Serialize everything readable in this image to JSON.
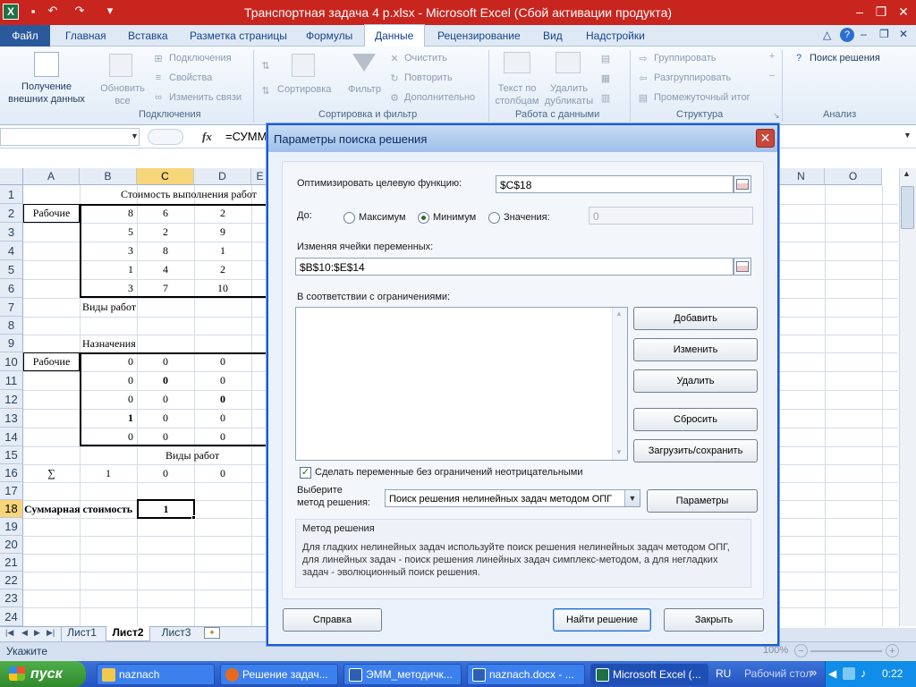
{
  "app": {
    "title": "Транспортная задача 4 р.xlsx  -  Microsoft Excel (Сбой активации продукта)"
  },
  "tabs": {
    "file": "Файл",
    "items": [
      "Главная",
      "Вставка",
      "Разметка страницы",
      "Формулы",
      "Данные",
      "Рецензирование",
      "Вид",
      "Надстройки"
    ]
  },
  "ribbon": {
    "get_external": "Получение внешних данных",
    "refresh_all": "Обновить все",
    "connections": "Подключения",
    "properties": "Свойства",
    "edit_links": "Изменить связи",
    "group_connections": "Подключения",
    "sort": "Сортировка",
    "filter": "Фильтр",
    "clear": "Очистить",
    "reapply": "Повторить",
    "advanced": "Дополнительно",
    "group_sort": "Сортировка и фильтр",
    "text_to_columns": "Текст по столбцам",
    "remove_duplicates": "Удалить дубликаты",
    "group_data_tools": "Работа с данными",
    "group": "Группировать",
    "ungroup": "Разгруппировать",
    "subtotal": "Промежуточный итог",
    "group_outline": "Структура",
    "solver": "Поиск решения",
    "group_analysis": "Анализ"
  },
  "formula": {
    "fx": "fx",
    "value": "=СУММ"
  },
  "sheet": {
    "columns": [
      "A",
      "B",
      "C",
      "D",
      "E",
      "N",
      "O"
    ],
    "rows": [
      "1",
      "2",
      "3",
      "4",
      "5",
      "6",
      "7",
      "8",
      "9",
      "10",
      "11",
      "12",
      "13",
      "14",
      "15",
      "16",
      "17",
      "18",
      "19",
      "20",
      "21",
      "22",
      "23",
      "24"
    ],
    "title_cost": "Стоимость выполнения работ",
    "label_workers": "Рабочие",
    "cost_matrix": [
      [
        "8",
        "6",
        "2"
      ],
      [
        "5",
        "2",
        "9"
      ],
      [
        "3",
        "8",
        "1"
      ],
      [
        "1",
        "4",
        "2"
      ],
      [
        "3",
        "7",
        "10"
      ]
    ],
    "label_work_types": "Виды работ",
    "label_assignments": "Назначения",
    "label_workers2": "Рабочие",
    "assign_matrix": [
      [
        "0",
        "0",
        "0"
      ],
      [
        "0",
        "0",
        "0"
      ],
      [
        "0",
        "0",
        "0"
      ],
      [
        "1",
        "0",
        "0"
      ],
      [
        "0",
        "0",
        "0"
      ]
    ],
    "label_work_types2": "Виды работ",
    "sum_symbol": "∑",
    "sums": [
      "1",
      "0",
      "0"
    ],
    "label_total_cost": "Суммарная стоимость",
    "total_cost": "1"
  },
  "sheet_tabs": [
    "Лист1",
    "Лист2",
    "Лист3"
  ],
  "status": {
    "text": "Укажите",
    "zoom": "100%"
  },
  "dialog": {
    "title": "Параметры поиска решения",
    "objective_label": "Оптимизировать целевую функцию:",
    "objective_value": "$C$18",
    "to_label": "До:",
    "opt_max": "Максимум",
    "opt_min": "Минимум",
    "opt_value": "Значения:",
    "value_input": "0",
    "vars_label": "Изменяя ячейки переменных:",
    "vars_value": "$B$10:$E$14",
    "constraints_label": "В соответствии с ограничениями:",
    "btn_add": "Добавить",
    "btn_change": "Изменить",
    "btn_delete": "Удалить",
    "btn_reset": "Сбросить",
    "btn_load": "Загрузить/сохранить",
    "nonneg_label": "Сделать переменные без ограничений неотрицательными",
    "method_label1": "Выберите",
    "method_label2": "метод решения:",
    "method_value": "Поиск решения нелинейных задач методом ОПГ",
    "btn_options": "Параметры",
    "method_title": "Метод решения",
    "method_desc": [
      "Для гладких нелинейных задач используйте поиск решения нелинейных задач методом ОПГ,",
      "для линейных задач - поиск решения линейных задач симплекс-методом, а для негладких",
      "задач - эволюционный поиск решения."
    ],
    "btn_help": "Справка",
    "btn_solve": "Найти решение",
    "btn_close": "Закрыть"
  },
  "taskbar": {
    "start": "пуск",
    "items": [
      "naznach",
      "Решение задач...",
      "ЭММ_методичк...",
      "naznach.docx - ...",
      "Microsoft Excel (..."
    ],
    "lang": "RU",
    "desktop": "Рабочий стол",
    "time": "0:22"
  }
}
